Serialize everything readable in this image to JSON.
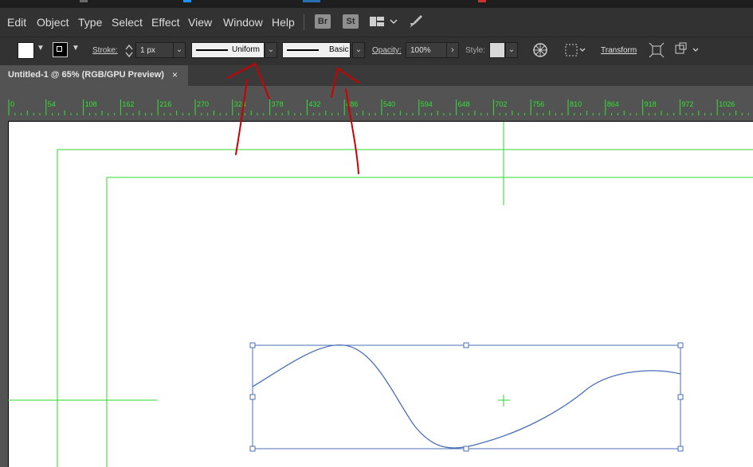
{
  "menu": [
    "Edit",
    "Object",
    "Type",
    "Select",
    "Effect",
    "View",
    "Window",
    "Help"
  ],
  "menu_icons": {
    "bridge": "Br",
    "stock": "St"
  },
  "control_bar": {
    "stroke_label": "Stroke:",
    "stroke_weight": "1 px",
    "variable_width_profile": "Uniform",
    "brush_definition": "Basic",
    "opacity_label": "Opacity:",
    "opacity_value": "100%",
    "style_label": "Style:",
    "transform_label": "Transform"
  },
  "document_tab": {
    "title": "Untitled-1 @ 65% (RGB/GPU Preview)",
    "close_glyph": "×"
  },
  "ruler_ticks": [
    "0",
    "54",
    "108",
    "162",
    "216",
    "270",
    "324",
    "378",
    "432",
    "486",
    "540",
    "594",
    "648",
    "702",
    "756",
    "810",
    "864",
    "918",
    "972",
    "1026"
  ],
  "colors": {
    "ui_dark": "#323232",
    "ui_mid": "#535353",
    "guide_green": "#2bd92b",
    "selection_blue": "#4a6fb5",
    "annotation_red": "#cc0000"
  }
}
